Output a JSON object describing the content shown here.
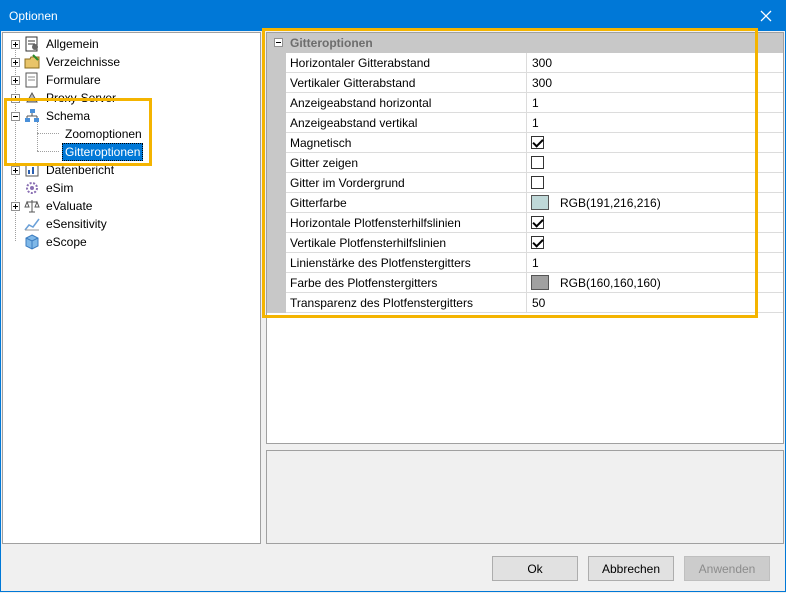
{
  "window": {
    "title": "Optionen"
  },
  "tree": {
    "items": [
      {
        "label": "Allgemein",
        "icon": "settings-sheet-icon"
      },
      {
        "label": "Verzeichnisse",
        "icon": "folder-icon"
      },
      {
        "label": "Formulare",
        "icon": "form-icon"
      },
      {
        "label": "Proxy-Server",
        "icon": "server-icon"
      },
      {
        "label": "Schema",
        "icon": "schema-icon"
      },
      {
        "label": "Zoomoptionen",
        "icon": ""
      },
      {
        "label": "Gitteroptionen",
        "icon": ""
      },
      {
        "label": "Datenbericht",
        "icon": "report-icon"
      },
      {
        "label": "eSim",
        "icon": "gear-icon"
      },
      {
        "label": "eValuate",
        "icon": "scales-icon"
      },
      {
        "label": "eSensitivity",
        "icon": "chart-icon"
      },
      {
        "label": "eScope",
        "icon": "cube-icon"
      }
    ],
    "selected": "Gitteroptionen"
  },
  "grid": {
    "category": "Gitteroptionen",
    "rows": [
      {
        "name": "Horizontaler Gitterabstand",
        "value": "300"
      },
      {
        "name": "Vertikaler Gitterabstand",
        "value": "300"
      },
      {
        "name": "Anzeigeabstand horizontal",
        "value": "1"
      },
      {
        "name": "Anzeigeabstand vertikal",
        "value": "1"
      },
      {
        "name": "Magnetisch",
        "checked": true
      },
      {
        "name": "Gitter zeigen",
        "checked": false
      },
      {
        "name": "Gitter im Vordergrund",
        "checked": false
      },
      {
        "name": "Gitterfarbe",
        "color_text": "RGB(191,216,216)",
        "swatch": "#bfd8d8"
      },
      {
        "name": "Horizontale Plotfensterhilfslinien",
        "checked": true
      },
      {
        "name": "Vertikale Plotfensterhilfslinien",
        "checked": true
      },
      {
        "name": "Linienstärke des Plotfenstergitters",
        "value": "1"
      },
      {
        "name": "Farbe des Plotfenstergitters",
        "color_text": "RGB(160,160,160)",
        "swatch": "#a0a0a0"
      },
      {
        "name": "Transparenz des Plotfenstergitters",
        "value": "50"
      }
    ]
  },
  "buttons": {
    "ok": "Ok",
    "cancel": "Abbrechen",
    "apply": "Anwenden"
  },
  "colors": {
    "accent": "#0078d7",
    "highlight": "#f4b400"
  }
}
